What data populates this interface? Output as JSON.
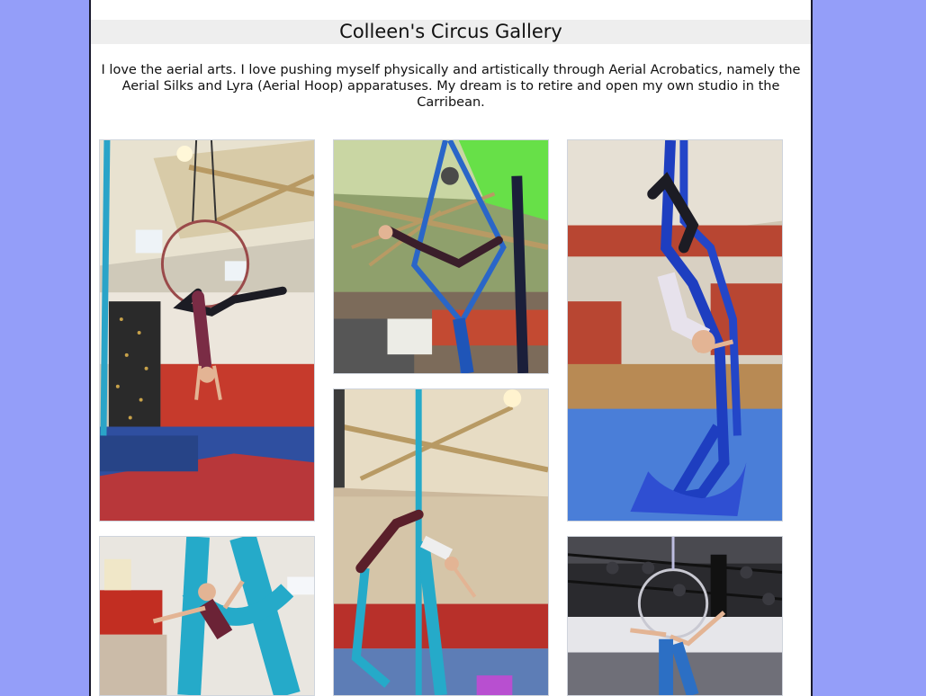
{
  "gallery": {
    "title": "Colleen's Circus Gallery",
    "intro": "I love the aerial arts. I love pushing myself physically and artistically through Aerial Acrobatics, namely the Aerial Silks and Lyra (Aerial Hoop) apparatuses. My dream is to retire and open my own studio in the Carribean.",
    "photos": [
      {
        "alt": "Lyra hoop pose in gym with climbing wall"
      },
      {
        "alt": "Blue silks split pose under green light"
      },
      {
        "alt": "Blue silks inverted wrap over gym floor"
      },
      {
        "alt": "Teal silks hammock pose"
      },
      {
        "alt": "Teal silks inverted split in gym"
      },
      {
        "alt": "Lyra hoop backbend in dark studio"
      }
    ]
  },
  "colors": {
    "background": "#949ef9",
    "page": "#ffffff",
    "title_bar": "#eeeeee"
  }
}
